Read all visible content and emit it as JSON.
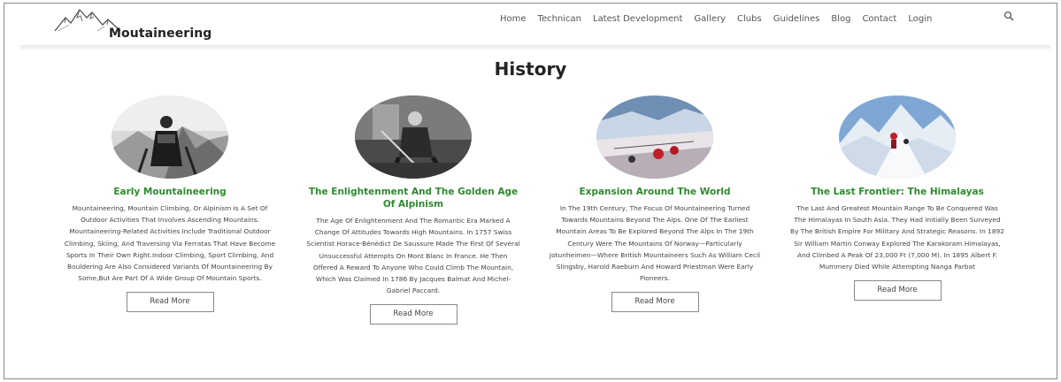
{
  "header": {
    "brand": "Moutaineering",
    "nav": [
      "Home",
      "Technican",
      "Latest Development",
      "Gallery",
      "Clubs",
      "Guidelines",
      "Blog",
      "Contact",
      "Login"
    ]
  },
  "page": {
    "title": "History"
  },
  "cards": [
    {
      "title": "Early Mountaineering",
      "text": "Mountaineering, Mountain Climbing, Or Alpinism Is A Set Of Outdoor Activities That Involves Ascending Mountains. Mountaineering-Related Activities Include Traditional Outdoor Climbing, Skiing, And Traversing Via Ferratas That Have Become Sports In Their Own Right.Indoor Climbing, Sport Climbing, And Bouldering Are Also Considered Variants Of Mountaineering By Some,But Are Part Of A Wide Group Of Mountain Sports.",
      "button": "Read More"
    },
    {
      "title": "The Enlightenment And The Golden Age Of Alpinism",
      "text": "The Age Of Enlightenment And The Romantic Era Marked A Change Of Attitudes Towards High Mountains. In 1757 Swiss Scientist Horace-Bénédict De Saussure Made The First Of Several Unsuccessful Attempts On Mont Blanc In France. He Then Offered A Reward To Anyone Who Could Climb The Mountain, Which Was Claimed In 1786 By Jacques Balmat And Michel-Gabriel Paccard.",
      "button": "Read More"
    },
    {
      "title": "Expansion Around The World",
      "text": "In The 19th Century, The Focus Of Mountaineering Turned Towards Mountains Beyond The Alps. One Of The Earliest Mountain Areas To Be Explored Beyond The Alps In The 19th Century Were The Mountains Of Norway—Particularly Jotunheimen—Where British Mountaineers Such As William Cecil Slingsby, Harold Raeburn And Howard Priestman Were Early Pioneers.",
      "button": "Read More"
    },
    {
      "title": "The Last Frontier: The Himalayas",
      "text": "The Last And Greatest Mountain Range To Be Conquered Was The Himalayas In South Asia. They Had Initially Been Surveyed By The British Empire For Military And Strategic Reasons. In 1892 Sir William Martin Conway Explored The Karakoram Himalayas, And Climbed A Peak Of 23,000 Ft (7,000 M). In 1895 Albert F. Mummery Died While Attempting Nanga Parbat",
      "button": "Read More"
    }
  ],
  "icons": {
    "logo": "mountain-logo-icon",
    "search": "search-icon"
  },
  "colors": {
    "card_title": "#2e8a2e",
    "text": "#444444"
  }
}
